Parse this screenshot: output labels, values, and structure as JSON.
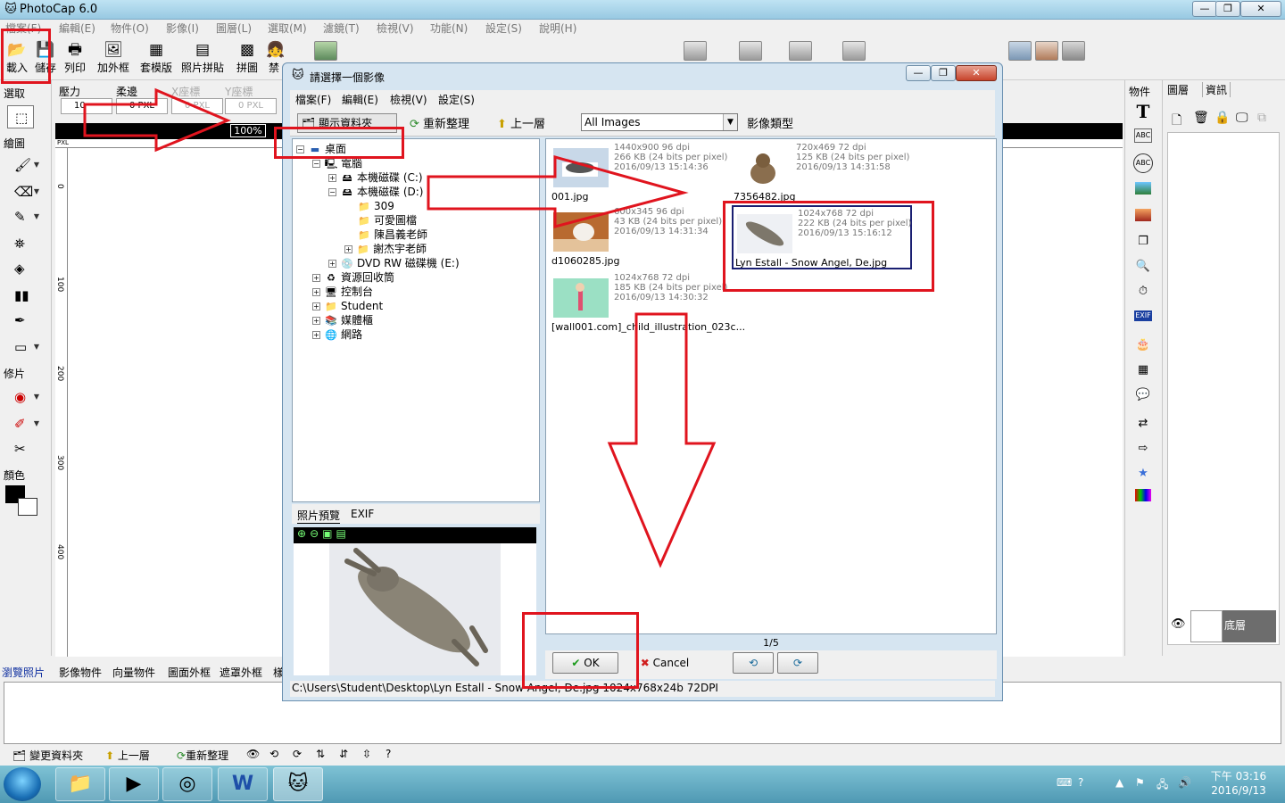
{
  "window": {
    "title": "PhotoCap 6.0",
    "controls": [
      "—",
      "❐",
      "✕"
    ]
  },
  "menubar": [
    "檔案(F)",
    "編輯(E)",
    "物件(O)",
    "影像(I)",
    "圖層(L)",
    "選取(M)",
    "濾鏡(T)",
    "檢視(V)",
    "功能(N)",
    "設定(S)",
    "說明(H)"
  ],
  "toolbar": [
    {
      "label": "載入",
      "icon": "open-folder-icon"
    },
    {
      "label": "儲存",
      "icon": "save-icon"
    },
    {
      "label": "列印",
      "icon": "print-icon"
    },
    {
      "label": "加外框",
      "icon": "frame-icon"
    },
    {
      "label": "套模版",
      "icon": "template-icon"
    },
    {
      "label": "照片拼貼",
      "icon": "collage-icon"
    },
    {
      "label": "拼圖",
      "icon": "puzzle-icon"
    },
    {
      "label": "禁",
      "icon": "person-icon"
    }
  ],
  "left_panel": {
    "select": "選取",
    "draw": "繪圖",
    "retouch": "修片",
    "color": "顏色"
  },
  "options": {
    "pressure": "壓力",
    "soft_edge": "柔邊",
    "x_coord": "X座標",
    "y_coord": "Y座標",
    "pressure_val": "10",
    "soft_val": "0 PXL",
    "x_val": "0 PXL",
    "y_val": "0 PXL",
    "zoom": "100%"
  },
  "ruler": {
    "unit": "PXL",
    "marks": [
      "0",
      "100",
      "200",
      "300",
      "400"
    ]
  },
  "right_panel": {
    "objects_title": "物件",
    "layers_tab": "圖層",
    "info_tab": "資訊",
    "base_layer": "底層"
  },
  "bottom_tabs": [
    "瀏覽照片",
    "影像物件",
    "向量物件",
    "圖面外框",
    "遮罩外框",
    "樣"
  ],
  "bottom_toolbar": {
    "change_folder": "變更資料夾",
    "up_level": "上一層",
    "refresh": "重新整理",
    "help": "?"
  },
  "taskbar": {
    "time": "下午 03:16",
    "date": "2016/9/13"
  },
  "dialog": {
    "title": "請選擇一個影像",
    "menu": [
      "檔案(F)",
      "編輯(E)",
      "檢視(V)",
      "設定(S)"
    ],
    "show_folder": "顯示資料夾",
    "refresh": "重新整理",
    "up_level": "上一層",
    "filter": "All Images",
    "image_type": "影像類型",
    "tree": [
      {
        "label": "桌面",
        "level": 0,
        "exp": "−"
      },
      {
        "label": "電腦",
        "level": 1,
        "exp": "−"
      },
      {
        "label": "本機磁碟 (C:)",
        "level": 2,
        "exp": "+"
      },
      {
        "label": "本機磁碟 (D:)",
        "level": 2,
        "exp": "−"
      },
      {
        "label": "309",
        "level": 3,
        "exp": ""
      },
      {
        "label": "可愛圖檔",
        "level": 3,
        "exp": ""
      },
      {
        "label": "陳昌義老師",
        "level": 3,
        "exp": ""
      },
      {
        "label": "謝杰宇老師",
        "level": 3,
        "exp": "+"
      },
      {
        "label": "DVD RW 磁碟機 (E:)",
        "level": 2,
        "exp": "+"
      },
      {
        "label": "資源回收筒",
        "level": 1,
        "exp": "+"
      },
      {
        "label": "控制台",
        "level": 1,
        "exp": "+"
      },
      {
        "label": "Student",
        "level": 1,
        "exp": "+"
      },
      {
        "label": "媒體櫃",
        "level": 1,
        "exp": "+"
      },
      {
        "label": "網路",
        "level": 1,
        "exp": "+"
      }
    ],
    "preview_tab": "照片預覽",
    "exif_tab": "EXIF",
    "files": [
      {
        "name": "001.jpg",
        "l1": "1440x900 96 dpi",
        "l2": "266 KB (24 bits per pixel)",
        "l3": "2016/09/13 15:14:36"
      },
      {
        "name": "7356482.jpg",
        "l1": "720x469 72 dpi",
        "l2": "125 KB (24 bits per pixel)",
        "l3": "2016/09/13 14:31:58"
      },
      {
        "name": "d1060285.jpg",
        "l1": "600x345 96 dpi",
        "l2": "43 KB (24 bits per pixel)",
        "l3": "2016/09/13 14:31:34"
      },
      {
        "name": "Lyn Estall - Snow Angel, De.jpg",
        "l1": "1024x768 72 dpi",
        "l2": "222 KB (24 bits per pixel)",
        "l3": "2016/09/13 15:16:12"
      },
      {
        "name": "[wall001.com]_child_illustration_023c...",
        "l1": "1024x768 72 dpi",
        "l2": "185 KB (24 bits per pixel)",
        "l3": "2016/09/13 14:30:32"
      }
    ],
    "pager": "1/5",
    "ok": "OK",
    "cancel": "Cancel",
    "status": "C:\\Users\\Student\\Desktop\\Lyn Estall - Snow Angel, De.jpg   1024x768x24b   72DPI"
  },
  "colors": {
    "annotation": "#e0141e",
    "selection": "#1a1f72"
  }
}
